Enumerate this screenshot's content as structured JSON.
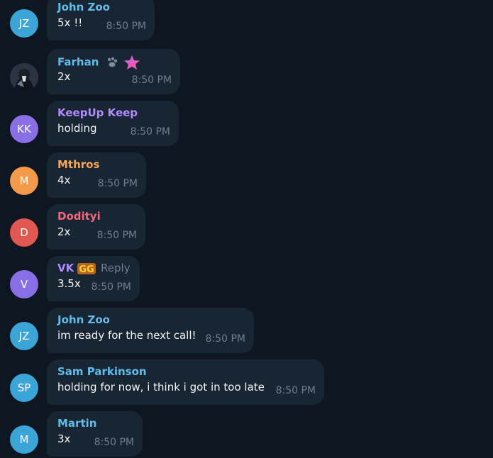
{
  "messages": [
    {
      "initials": "JZ",
      "avatar_color": "#3ba5d8",
      "sender": "John Zoo",
      "sender_color": "#62bcea",
      "text": "5x !!",
      "time": "8:50 PM"
    },
    {
      "initials": "",
      "avatar_color": "#1f2a37",
      "sender": "Farhan",
      "sender_color": "#62bcea",
      "text": "2x",
      "time": "8:50 PM",
      "badges": [
        "paw-icon",
        "star-icon"
      ]
    },
    {
      "initials": "KK",
      "avatar_color": "#8a6ee6",
      "sender": "KeepUp Keep",
      "sender_color": "#b38aff",
      "text": "holding",
      "time": "8:50 PM"
    },
    {
      "initials": "M",
      "avatar_color": "#f2994a",
      "sender": "Mthros",
      "sender_color": "#f5a65b",
      "text": "4x",
      "time": "8:50 PM"
    },
    {
      "initials": "D",
      "avatar_color": "#e0584f",
      "sender": "Dodityi",
      "sender_color": "#f06a7e",
      "text": "2x",
      "time": "8:50 PM"
    },
    {
      "initials": "V",
      "avatar_color": "#8a6ee6",
      "sender": "VK",
      "sender_color": "#b38aff",
      "text": "3.5x",
      "time": "8:50 PM",
      "reply": "Reply",
      "badges": [
        "gg-icon"
      ]
    },
    {
      "initials": "JZ",
      "avatar_color": "#3ba5d8",
      "sender": "John Zoo",
      "sender_color": "#62bcea",
      "text": "im ready for the next call!",
      "time": "8:50 PM"
    },
    {
      "initials": "SP",
      "avatar_color": "#3ba5d8",
      "sender": "Sam Parkinson",
      "sender_color": "#62bcea",
      "text": "holding for now, i think i got in too late",
      "time": "8:50 PM"
    },
    {
      "initials": "M",
      "avatar_color": "#3ba5d8",
      "sender": "Martin",
      "sender_color": "#62bcea",
      "text": "3x",
      "time": "8:50 PM"
    }
  ]
}
